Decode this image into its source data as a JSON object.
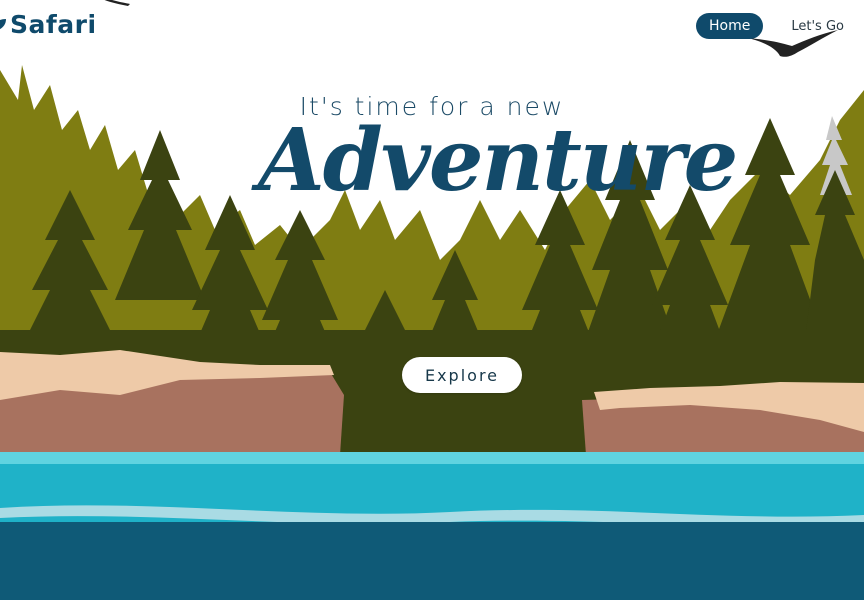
{
  "brand": {
    "name": "Safari",
    "icon": "leaf-logo-icon"
  },
  "nav": {
    "items": [
      {
        "label": "Home",
        "active": true
      },
      {
        "label": "Let's Go",
        "active": false
      }
    ]
  },
  "hero": {
    "subtitle": "It's time for a new",
    "headline": "Adventure",
    "cta_label": "Explore"
  },
  "colors": {
    "brand": "#0f4a6b",
    "forest_light": "#7a7a10",
    "forest_dark": "#3c4a10",
    "water": "#1aa8c0",
    "cliff": "#b98a74"
  }
}
